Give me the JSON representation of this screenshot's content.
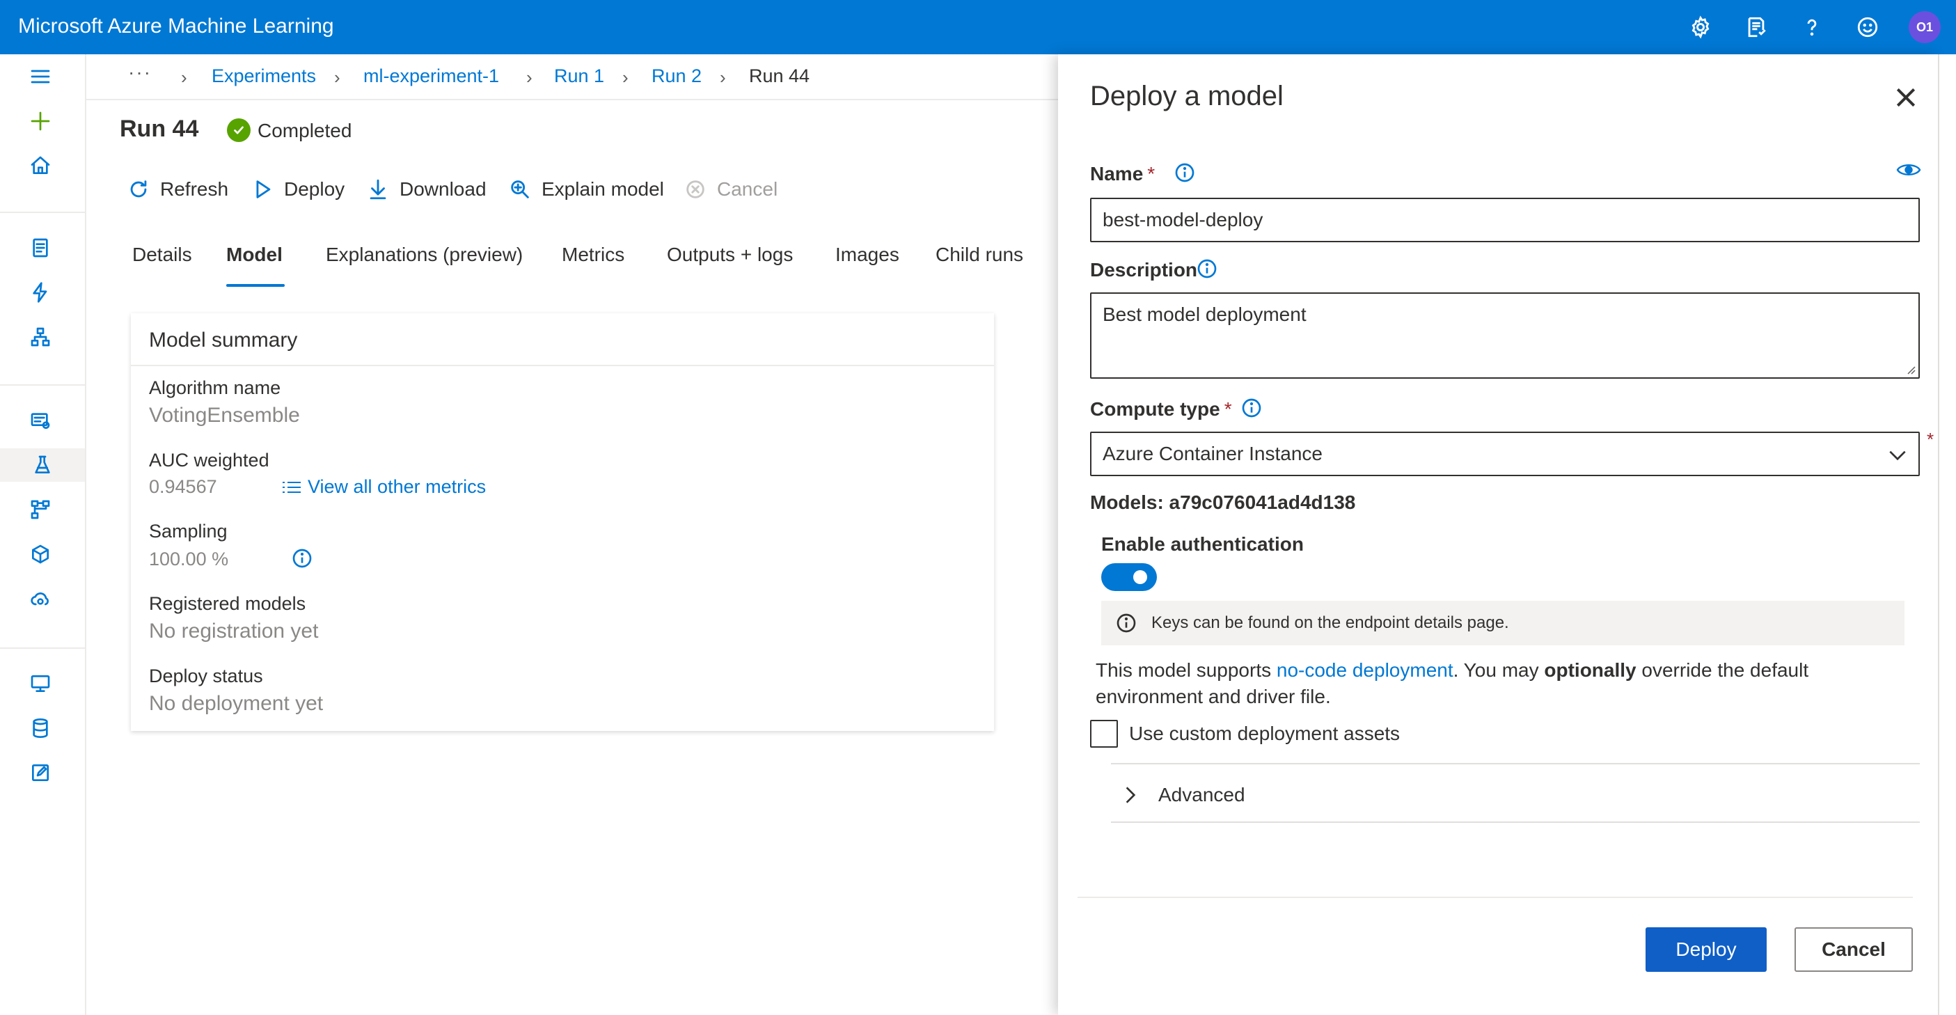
{
  "app": {
    "title": "Microsoft Azure Machine Learning",
    "avatar_initials": "O1",
    "accent_color": "#0078d4"
  },
  "topbar_icons": [
    "gear-icon",
    "feedback-list-icon",
    "help-icon",
    "smiley-icon"
  ],
  "leftnav_icons": [
    "hamburger-icon",
    "plus-icon",
    "home-icon",
    "notebook-icon",
    "automl-icon",
    "designer-icon",
    "datasets-icon",
    "experiments-icon",
    "pipelines-icon",
    "models-icon",
    "endpoints-icon",
    "compute-icon",
    "datastores-icon",
    "labeling-icon"
  ],
  "breadcrumb": {
    "more": "···",
    "items": [
      "Experiments",
      "ml-experiment-1",
      "Run 1",
      "Run 2",
      "Run 44"
    ]
  },
  "run": {
    "title": "Run 44",
    "status": "Completed",
    "status_color": "#57a300"
  },
  "commands": {
    "refresh": "Refresh",
    "deploy": "Deploy",
    "download": "Download",
    "explain": "Explain model",
    "cancel": "Cancel"
  },
  "tabs": [
    "Details",
    "Model",
    "Explanations (preview)",
    "Metrics",
    "Outputs + logs",
    "Images",
    "Child runs"
  ],
  "active_tab": "Model",
  "summary": {
    "title": "Model summary",
    "algorithm_label": "Algorithm name",
    "algorithm_value": "VotingEnsemble",
    "auc_label": "AUC weighted",
    "auc_value": "0.94567",
    "metrics_link": "View all other metrics",
    "sampling_label": "Sampling",
    "sampling_value": "100.00 %",
    "registered_label": "Registered models",
    "registered_value": "No registration yet",
    "deploy_status_label": "Deploy status",
    "deploy_status_value": "No deployment yet"
  },
  "panel": {
    "title": "Deploy a model",
    "name_label": "Name",
    "name_value": "best-model-deploy",
    "description_label": "Description",
    "description_value": "Best model deployment",
    "compute_label": "Compute type",
    "compute_value": "Azure Container Instance",
    "required_mark": "*",
    "models_line": "Models: a79c076041ad4d138",
    "auth_label": "Enable authentication",
    "auth_enabled": true,
    "keys_info": "Keys can be found on the endpoint details page.",
    "support_prefix": "This model supports ",
    "support_link": "no-code deployment",
    "support_mid": ". You may ",
    "support_bold": "optionally",
    "support_suffix": " override the default environment and driver file.",
    "custom_assets_label": "Use custom deployment assets",
    "custom_assets_checked": false,
    "advanced_label": "Advanced",
    "deploy_button": "Deploy",
    "cancel_button": "Cancel",
    "deploy_button_color": "#0f5fc7"
  }
}
